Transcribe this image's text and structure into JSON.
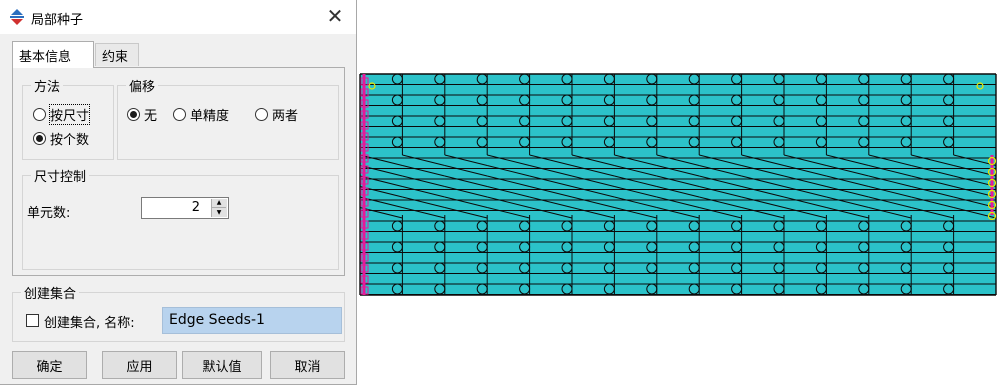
{
  "dialog": {
    "title": "局部种子",
    "close_glyph": "✕",
    "tabs": [
      {
        "label": "基本信息",
        "active": true
      },
      {
        "label": "约束",
        "active": false
      }
    ],
    "method": {
      "title": "方法",
      "options": [
        {
          "label": "按尺寸",
          "selected": false
        },
        {
          "label": "按个数",
          "selected": true
        }
      ]
    },
    "bias": {
      "title": "偏移",
      "options": [
        {
          "label": "无",
          "selected": true
        },
        {
          "label": "单精度",
          "selected": false
        },
        {
          "label": "两者",
          "selected": false
        }
      ]
    },
    "size_control": {
      "title": "尺寸控制",
      "element_count_label": "单元数:",
      "element_count": "2"
    },
    "create_set": {
      "title": "创建集合",
      "checkbox_label": "创建集合, 名称:",
      "checked": false,
      "name_value": "Edge Seeds-1"
    },
    "buttons": {
      "ok": "确定",
      "apply": "应用",
      "defaults": "默认值",
      "cancel": "取消"
    }
  },
  "colors": {
    "mesh_fill": "#2cc2c9",
    "mesh_line": "#0a0a0a",
    "selected_edge": "#e8179a",
    "seed_marker": "#e8e800"
  }
}
